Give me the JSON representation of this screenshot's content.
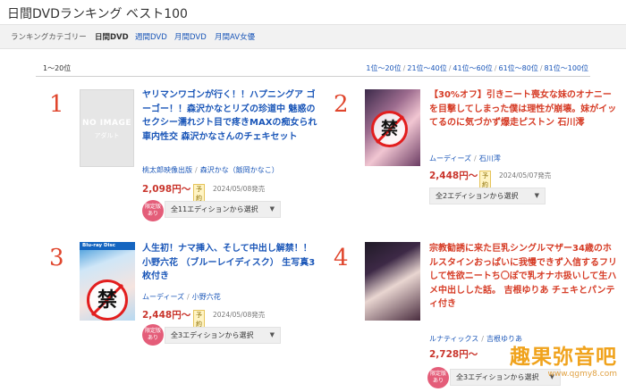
{
  "page_title": "日間DVDランキング ベスト100",
  "categories": {
    "label": "ランキングカテゴリー",
    "items": [
      "日間DVD",
      "週間DVD",
      "月間DVD",
      "月間AV女優"
    ]
  },
  "pager": {
    "count": "1〜20位",
    "links": [
      "1位〜20位",
      "21位〜40位",
      "41位〜60位",
      "61位〜80位",
      "81位〜100位"
    ]
  },
  "items": [
    {
      "rank": "1",
      "thumb_text": "NO IMAGE",
      "thumb_sub": "アダルト",
      "title": "ヤリマンワゴンが行く！！ハプニングア ゴーゴー！！森沢かなとリズの珍道中 魅惑のセクシー濡れジト目で疼きMAXの痴女られ車内性交 森沢かなさんのチェキセット",
      "maker": "桃太郎映像出版",
      "actress": "森沢かな（飯岡かなこ）",
      "price": "2,098円〜",
      "yoyaku": "予約",
      "release": "2024/05/08発売",
      "badge": "限定版あり",
      "edition": "全11エディションから選択"
    },
    {
      "rank": "2",
      "title": "【30%オフ】引きニート喪女な妹のオナニーを目撃してしまった僕は理性が崩壊。妹がイッてるのに気づかず爆走ピストン 石川澪",
      "maker": "ムーディーズ",
      "actress": "石川澪",
      "price": "2,448円〜",
      "yoyaku": "予約",
      "release": "2024/05/07発売",
      "edition": "全2エディションから選択",
      "censor": "禁"
    },
    {
      "rank": "3",
      "title": "人生初！ナマ挿入、そして中出し解禁！！ 小野六花 （ブルーレイディスク） 生写真3枚付き",
      "maker": "ムーディーズ",
      "actress": "小野六花",
      "price": "2,448円〜",
      "yoyaku": "予約",
      "release": "2024/05/08発売",
      "badge": "限定版あり",
      "edition": "全3エディションから選択",
      "censor": "禁",
      "bluray": "Blu-ray Disc"
    },
    {
      "rank": "4",
      "title": "宗教勧誘に来た巨乳シングルマザー34歳のホルスタインおっぱいに我慢できず入信するフリして性欲ニートち〇ぽで乳オナホ扱いして生ハメ中出しした話。 吉根ゆりあ チェキとパンティ付き",
      "maker": "ルナティックス",
      "actress": "吉根ゆりあ",
      "price": "2,728円〜",
      "badge": "限定版あり",
      "edition": "全3エディションから選択"
    }
  ],
  "watermark": {
    "text": "趣果弥音吧",
    "url": "www.qgmy8.com"
  },
  "colors": {
    "rank": "#e0462d",
    "link": "#1a56b8",
    "price": "#c9352c",
    "badge": "#e45d79",
    "censor": "#e21e1e"
  }
}
